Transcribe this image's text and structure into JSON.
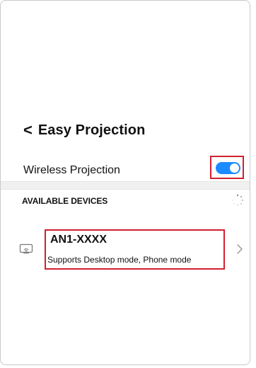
{
  "header": {
    "back_glyph": "<",
    "title": "Easy Projection"
  },
  "wireless_projection": {
    "label": "Wireless Projection",
    "enabled": true,
    "toggle_color": "#1a8cff"
  },
  "available_devices": {
    "section_title": "AVAILABLE DEVICES",
    "loading_indicator": "spinner-icon",
    "devices": [
      {
        "icon": "screen-cast-icon",
        "name": "AN1-XXXX",
        "modes": "Supports Desktop mode, Phone mode",
        "chevron": "chevron-right-icon"
      }
    ]
  },
  "highlight_color": "#d2202f"
}
